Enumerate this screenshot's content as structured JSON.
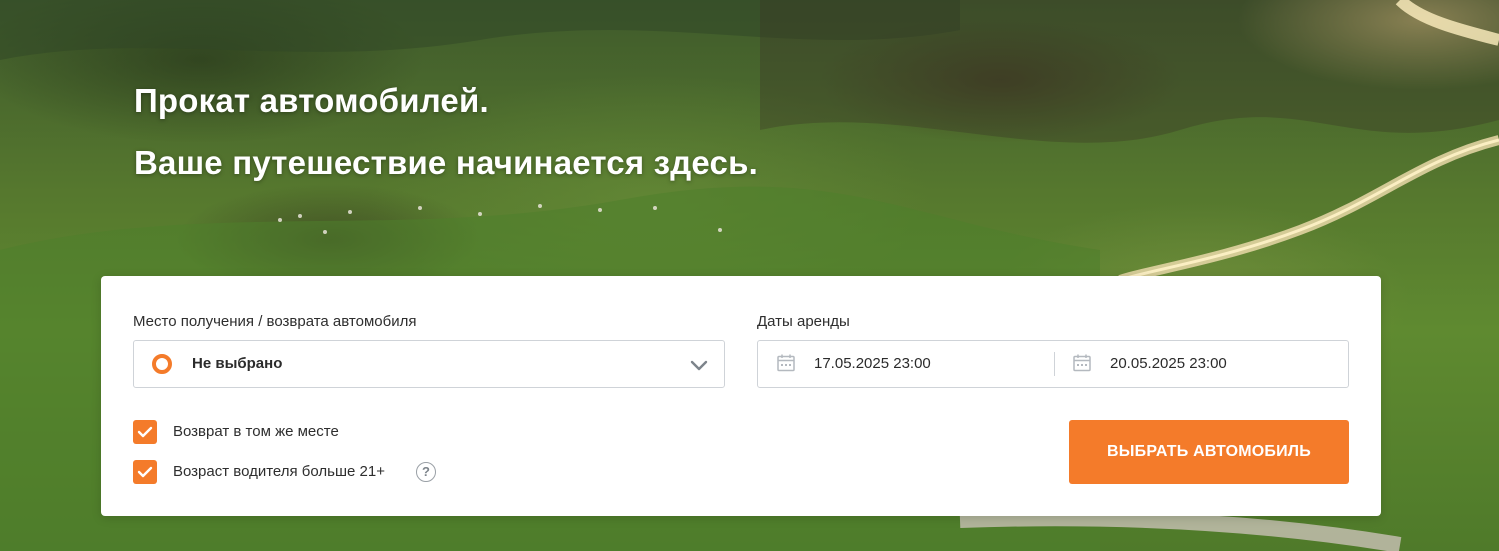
{
  "hero": {
    "headline_line1": "Прокат автомобилей.",
    "headline_line2": "Ваше путешествие начинается здесь."
  },
  "search_form": {
    "location_label": "Место получения / возврата автомобиля",
    "location_value": "Не выбрано",
    "location_icon": "location-ring-icon",
    "dates_label": "Даты аренды",
    "pickup_datetime": "17.05.2025 23:00",
    "return_datetime": "20.05.2025 23:00",
    "calendar_icon": "calendar-icon",
    "same_place_return": {
      "label": "Возврат в том же месте",
      "checked": true
    },
    "driver_age": {
      "label": "Возраст водителя больше 21+",
      "checked": true,
      "help_glyph": "?"
    },
    "submit_label": "ВЫБРАТЬ АВТОМОБИЛЬ"
  },
  "colors": {
    "accent": "#f47b2a",
    "text": "#2e2e2e",
    "border": "#cfd3d8",
    "card_bg": "#ffffff"
  }
}
